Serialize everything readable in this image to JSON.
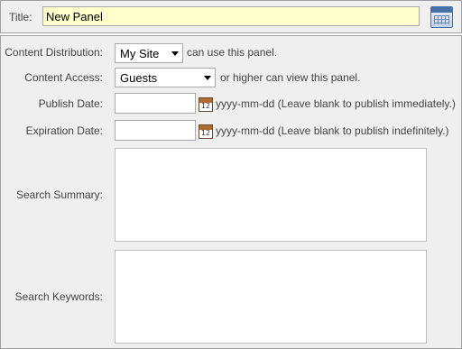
{
  "title": {
    "label": "Title:",
    "value": "New Panel"
  },
  "icons": {
    "title_calendar": "calendar-grid-icon",
    "date_picker": "date-picker-icon"
  },
  "form": {
    "content_distribution": {
      "label": "Content Distribution:",
      "selected": "My Site",
      "suffix": "can use this panel."
    },
    "content_access": {
      "label": "Content Access:",
      "selected": "Guests",
      "suffix": "or higher can view this panel."
    },
    "publish_date": {
      "label": "Publish Date:",
      "value": "",
      "icon_text": "12",
      "hint": "yyyy-mm-dd (Leave blank to publish immediately.)"
    },
    "expiration_date": {
      "label": "Expiration Date:",
      "value": "",
      "icon_text": "12",
      "hint": "yyyy-mm-dd (Leave blank to publish indefinitely.)"
    },
    "search_summary": {
      "label": "Search Summary:",
      "value": ""
    },
    "search_keywords": {
      "label": "Search Keywords:",
      "value": ""
    }
  },
  "colors": {
    "panel_bg": "#efefef",
    "border": "#a0a0a0",
    "title_input_bg": "#ffffcc"
  }
}
